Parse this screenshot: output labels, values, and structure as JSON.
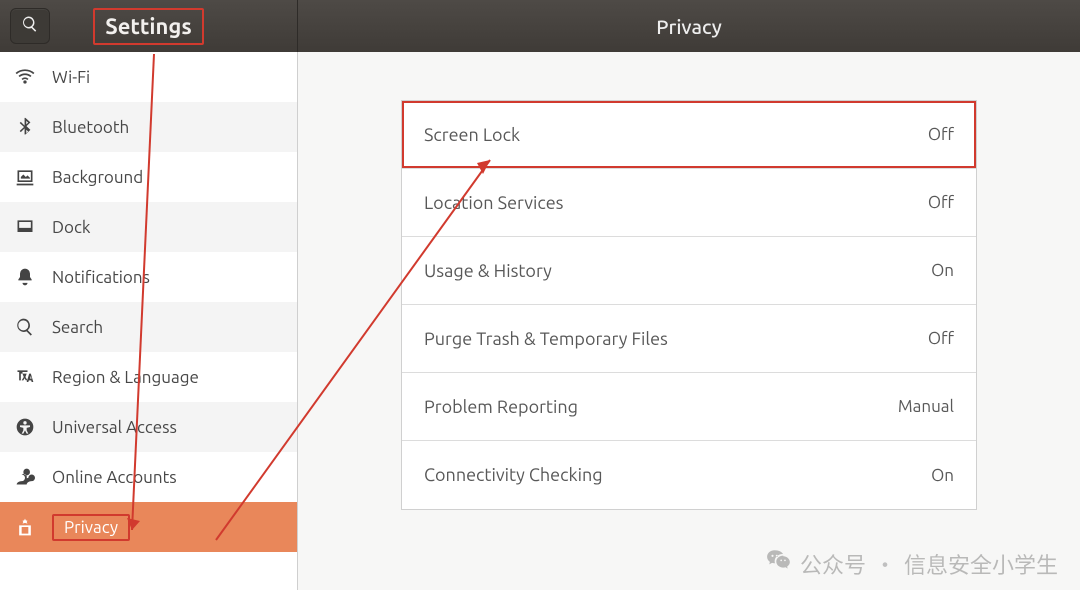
{
  "header": {
    "sidebar_title": "Settings",
    "page_title": "Privacy"
  },
  "sidebar": {
    "items": [
      {
        "key": "wifi",
        "label": "Wi-Fi"
      },
      {
        "key": "bluetooth",
        "label": "Bluetooth"
      },
      {
        "key": "background",
        "label": "Background"
      },
      {
        "key": "dock",
        "label": "Dock"
      },
      {
        "key": "notifications",
        "label": "Notifications"
      },
      {
        "key": "search",
        "label": "Search"
      },
      {
        "key": "region-language",
        "label": "Region & Language"
      },
      {
        "key": "universal-access",
        "label": "Universal Access"
      },
      {
        "key": "online-accounts",
        "label": "Online Accounts"
      },
      {
        "key": "privacy",
        "label": "Privacy",
        "active": true
      }
    ]
  },
  "privacy": {
    "rows": [
      {
        "key": "screen-lock",
        "label": "Screen Lock",
        "value": "Off",
        "highlight": true
      },
      {
        "key": "location-services",
        "label": "Location Services",
        "value": "Off"
      },
      {
        "key": "usage-history",
        "label": "Usage & History",
        "value": "On"
      },
      {
        "key": "purge-trash",
        "label": "Purge Trash & Temporary Files",
        "value": "Off"
      },
      {
        "key": "problem-reporting",
        "label": "Problem Reporting",
        "value": "Manual"
      },
      {
        "key": "connectivity-checking",
        "label": "Connectivity Checking",
        "value": "On"
      }
    ]
  },
  "watermark": {
    "prefix": "公众号",
    "dot": "·",
    "name": "信息安全小学生"
  }
}
